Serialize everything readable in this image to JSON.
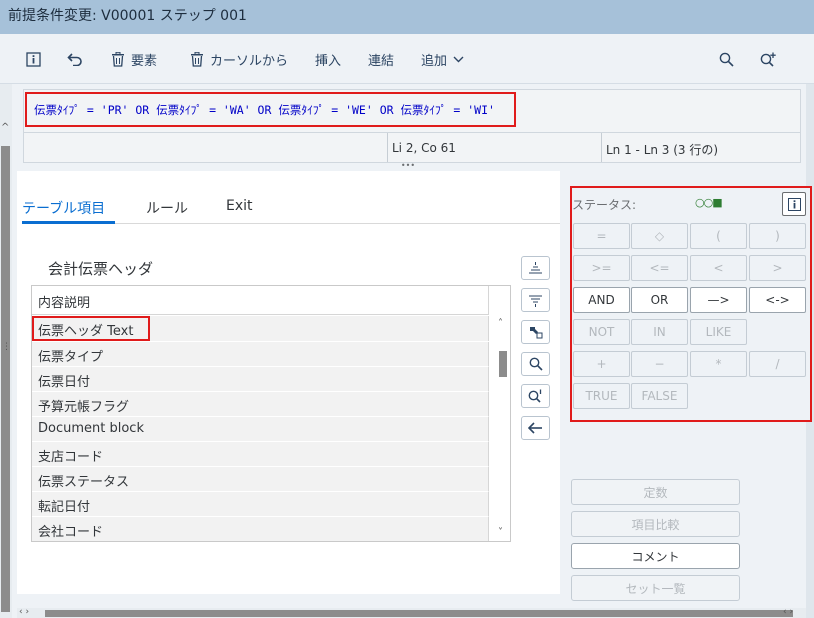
{
  "window": {
    "title": "前提条件変更: V00001 ステップ 001"
  },
  "toolbar": {
    "element_label": "要素",
    "from_cursor_label": "カーソルから",
    "insert_label": "挿入",
    "concat_label": "連結",
    "add_label": "追加"
  },
  "condition": {
    "expression": "伝票ﾀｲﾌﾟ = 'PR' OR 伝票ﾀｲﾌﾟ = 'WA' OR 伝票ﾀｲﾌﾟ = 'WE' OR 伝票ﾀｲﾌﾟ = 'WI'",
    "cursor_position": "Li 2, Co 61",
    "line_range": "Ln 1 - Ln 3 (3 行の)"
  },
  "tabs": [
    {
      "label": "テーブル項目",
      "active": true
    },
    {
      "label": "ルール",
      "active": false
    },
    {
      "label": "Exit",
      "active": false
    }
  ],
  "field_list": {
    "section_title": "会計伝票ヘッダ",
    "header": "内容説明",
    "rows": [
      "伝票ヘッダ Text",
      "伝票タイプ",
      "伝票日付",
      "予算元帳フラグ",
      "Document block",
      "支店コード",
      "伝票ステータス",
      "転記日付",
      "会社コード"
    ]
  },
  "operators": {
    "status_label": "ステータス:",
    "status_indicator": "○○■",
    "rows": [
      [
        "=",
        "◇",
        "(",
        ")"
      ],
      [
        ">=",
        "<=",
        "<",
        ">"
      ],
      [
        "AND",
        "OR",
        "—>",
        "<->"
      ],
      [
        "NOT",
        "IN",
        "LIKE"
      ],
      [
        "+",
        "−",
        "*",
        "/"
      ],
      [
        "TRUE",
        "FALSE"
      ]
    ]
  },
  "actions": {
    "constant_label": "定数",
    "compare_label": "項目比較",
    "comment_label": "コメント",
    "set_list_label": "セット一覧"
  }
}
